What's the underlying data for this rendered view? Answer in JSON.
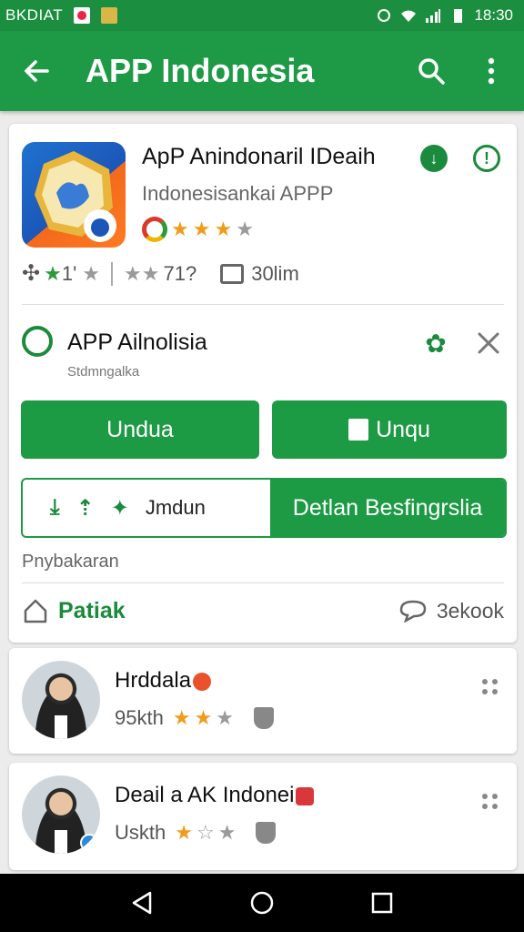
{
  "status_bar": {
    "carrier": "BKDIAT",
    "time": "18:30"
  },
  "app_bar": {
    "title": "APP Indonesia",
    "back_icon": "arrow-left-icon",
    "search_icon": "search-icon",
    "more_icon": "more-vert-icon"
  },
  "app": {
    "name": "ApP Anindonaril IDeaih",
    "developer": "Indonesisankai APPP",
    "rating_stars": 3,
    "rating_max": 4,
    "stats": {
      "rating_text": "1'",
      "reviews_text": "71?",
      "comments_text": "30lim"
    }
  },
  "promo": {
    "title": "APP Ailnolisia",
    "subtitle": "Stdmngalka"
  },
  "buttons": {
    "primary_left": "Undua",
    "primary_right": "Unqu",
    "toggle_left": "Jmdun",
    "toggle_right": "Detlan Besfingrslia"
  },
  "section": {
    "label": "Pnybakaran",
    "share_label": "Patiak",
    "comment_label": "3ekook"
  },
  "reviews": [
    {
      "name": "Hrddala",
      "meta": "95kth",
      "stars": 2,
      "stars_max": 3
    },
    {
      "name": "Deail a AK Indonei",
      "meta": "Uskth",
      "stars": 1,
      "stars_max": 3
    }
  ],
  "colors": {
    "brand_green": "#1e9a46",
    "star_on": "#f29a1a",
    "star_off": "#9a9a9a"
  }
}
